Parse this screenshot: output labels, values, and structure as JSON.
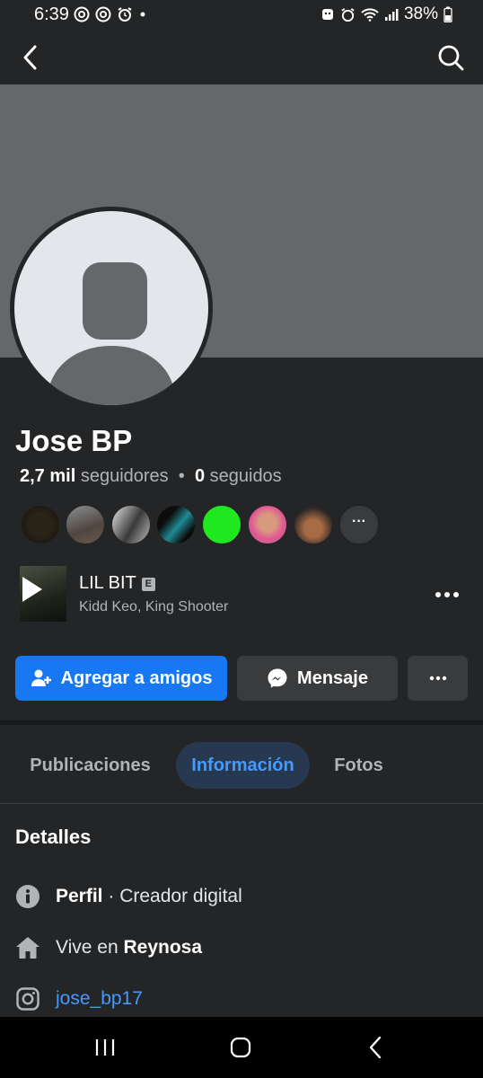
{
  "status_bar": {
    "time": "6:39",
    "battery": "38%"
  },
  "profile": {
    "name": "Jose BP",
    "followers_count": "2,7 mil",
    "followers_label": "seguidores",
    "separator": "•",
    "following_count": "0",
    "following_label": "seguidos",
    "follower_more": "···"
  },
  "featured_song": {
    "title": "LIL BIT",
    "explicit_badge": "E",
    "artists": "Kidd Keo, King Shooter"
  },
  "actions": {
    "add_friend": "Agregar a amigos",
    "message": "Mensaje"
  },
  "tabs": [
    "Publicaciones",
    "Información",
    "Fotos"
  ],
  "active_tab": "Información",
  "details": {
    "title": "Detalles",
    "profile_label": "Perfil",
    "profile_value": " · Creador digital",
    "lives_prefix": "Vive en ",
    "city": "Reynosa",
    "instagram": "jose_bp17"
  },
  "colors": {
    "background": "#242526",
    "accent_blue": "#1877f2",
    "link_blue": "#4599ff",
    "cover_gray": "#65676b"
  }
}
